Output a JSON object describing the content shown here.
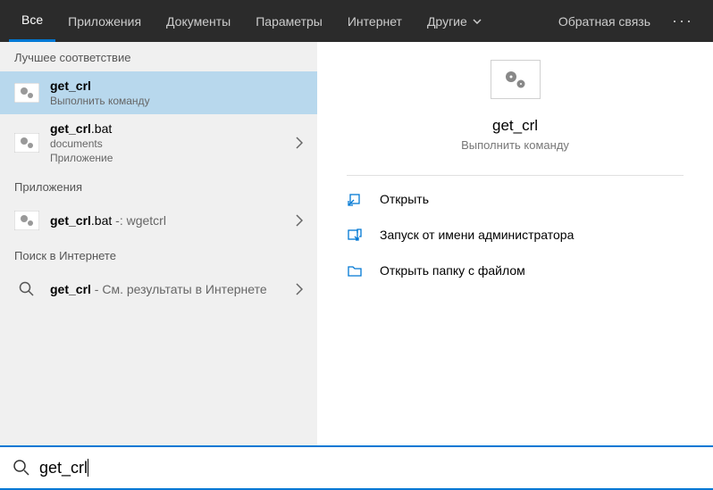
{
  "header": {
    "tabs": {
      "all": "Все",
      "apps": "Приложения",
      "docs": "Документы",
      "params": "Параметры",
      "internet": "Интернет",
      "other": "Другие"
    },
    "feedback": "Обратная связь"
  },
  "left": {
    "best_match": "Лучшее соответствие",
    "result1": {
      "title": "get_crl",
      "sub": "Выполнить команду"
    },
    "result2": {
      "title_pre": "get_crl",
      "title_ext": ".bat",
      "sub": "documents",
      "sub2": "Приложение"
    },
    "apps_header": "Приложения",
    "result3": {
      "title_pre": "get_crl",
      "title_ext": ".bat",
      "after": " -: wgetcrl"
    },
    "internet_header": "Поиск в Интернете",
    "result4": {
      "title": "get_crl",
      "after": " - См. результаты в Интернете"
    }
  },
  "right": {
    "title": "get_crl",
    "sub": "Выполнить команду",
    "actions": {
      "open": "Открыть",
      "admin": "Запуск от имени администратора",
      "folder": "Открыть папку с файлом"
    }
  },
  "search": {
    "value": "get_crl"
  }
}
